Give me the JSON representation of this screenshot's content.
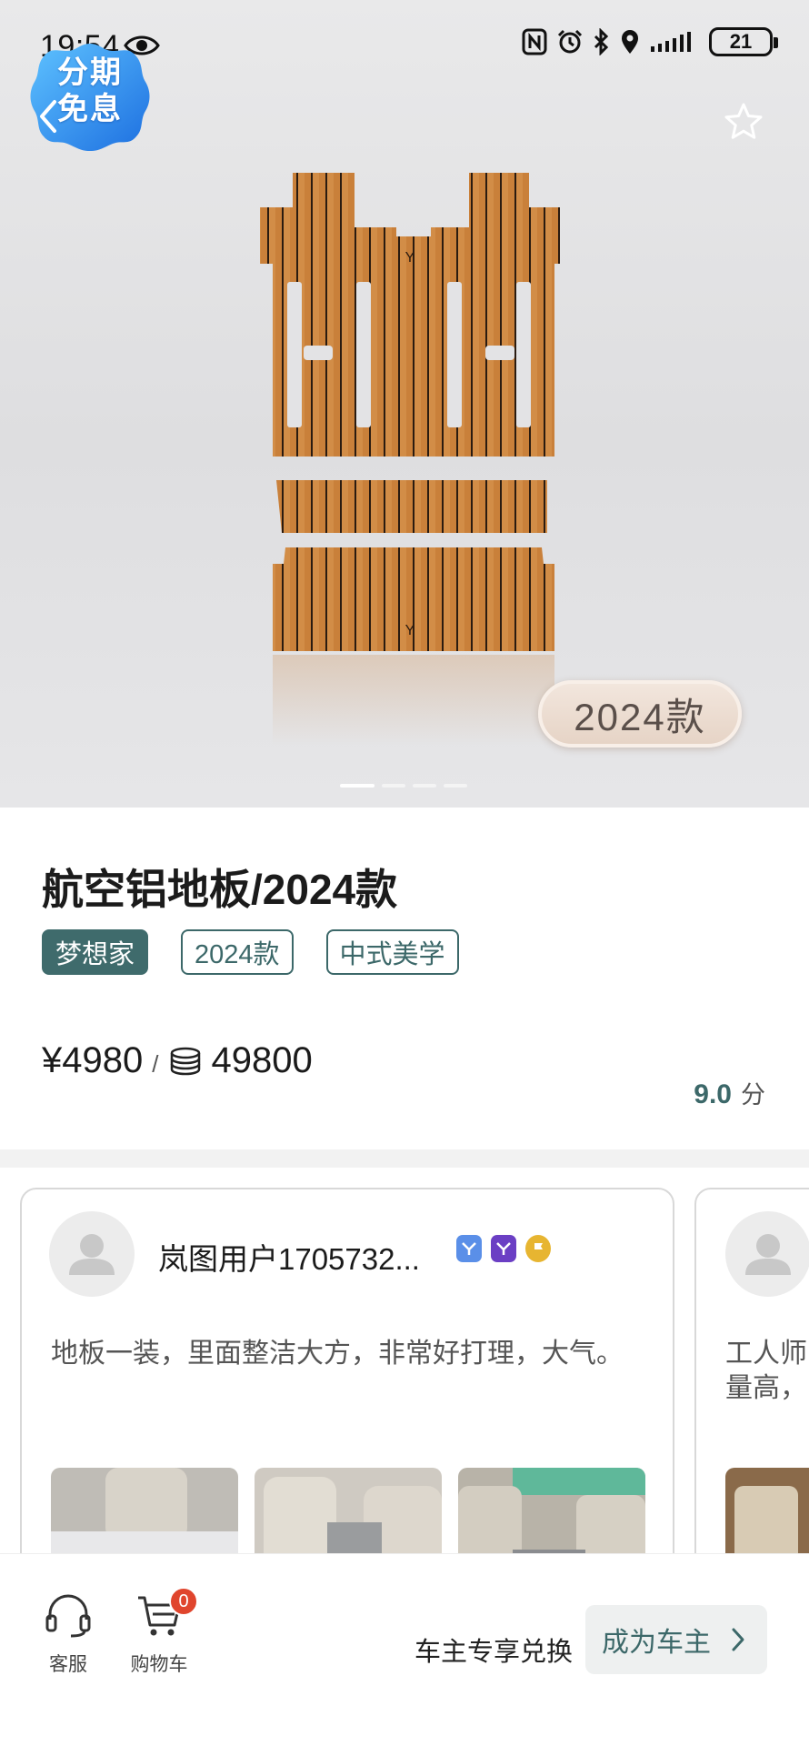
{
  "status_bar": {
    "time": "19:54",
    "battery": "21"
  },
  "promo_badge": {
    "line1": "分期",
    "line2": "免息"
  },
  "product": {
    "title": "航空铝地板/2024款",
    "year_pill": "2024款",
    "image_count": 4,
    "active_image_index": 1,
    "tags": [
      "梦想家",
      "2024款",
      "中式美学"
    ],
    "price_rmb": "¥4980",
    "price_separator": "/",
    "price_points": "49800",
    "score_value": "9.0",
    "score_unit": "分"
  },
  "reviews": [
    {
      "username": "岚图用户1705732...",
      "text": "地板一装，里面整洁大方，非常好打理，大气。",
      "badges": [
        "brand-badge-blue",
        "brand-badge-purple",
        "flag-badge-gold"
      ],
      "photo_count": 3
    },
    {
      "username": "",
      "text_line1": "工人师",
      "text_line2": "量高，",
      "photo_count": 1
    }
  ],
  "bottom_bar": {
    "service_label": "客服",
    "cart_label": "购物车",
    "cart_count": "0",
    "redeem_label": "车主专享兑换",
    "owner_button_label": "成为车主"
  },
  "colors": {
    "accent_teal": "#3c6869",
    "badge_red": "#e0452d",
    "wood": "#c57a34"
  }
}
